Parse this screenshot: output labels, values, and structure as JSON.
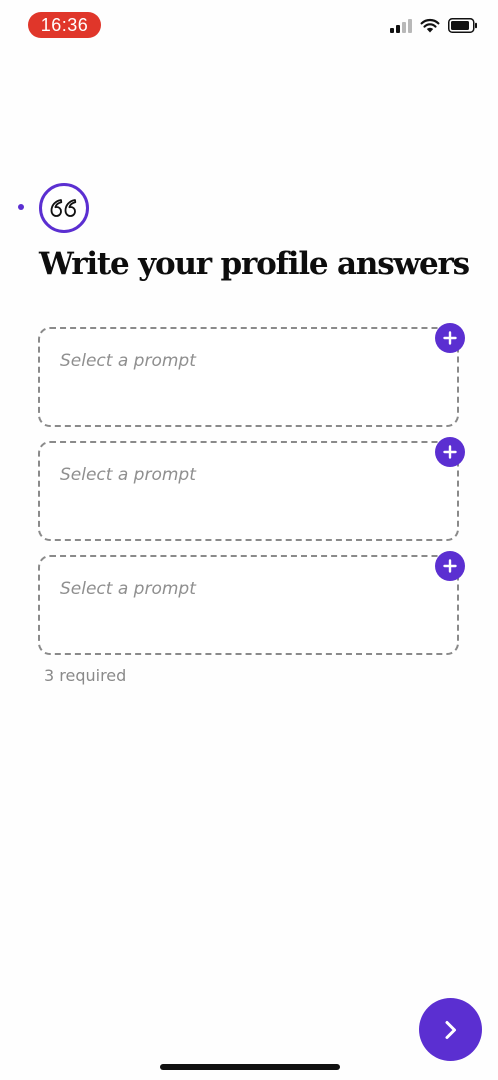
{
  "status_bar": {
    "time": "16:36",
    "icons": [
      "cellular-signal-icon",
      "wifi-icon",
      "battery-icon"
    ],
    "time_pill_color": "#e0362a"
  },
  "header": {
    "icon": "quote-icon",
    "title": "Write your profile answers"
  },
  "prompts": [
    {
      "placeholder": "Select a prompt",
      "action_icon": "plus-icon"
    },
    {
      "placeholder": "Select a prompt",
      "action_icon": "plus-icon"
    },
    {
      "placeholder": "Select a prompt",
      "action_icon": "plus-icon"
    }
  ],
  "required_note": "3 required",
  "next_button": {
    "icon": "chevron-right-icon"
  },
  "colors": {
    "accent": "#5b2fd1",
    "placeholder_text": "#8f8f8f",
    "border_dashed": "#8a8a8a"
  }
}
